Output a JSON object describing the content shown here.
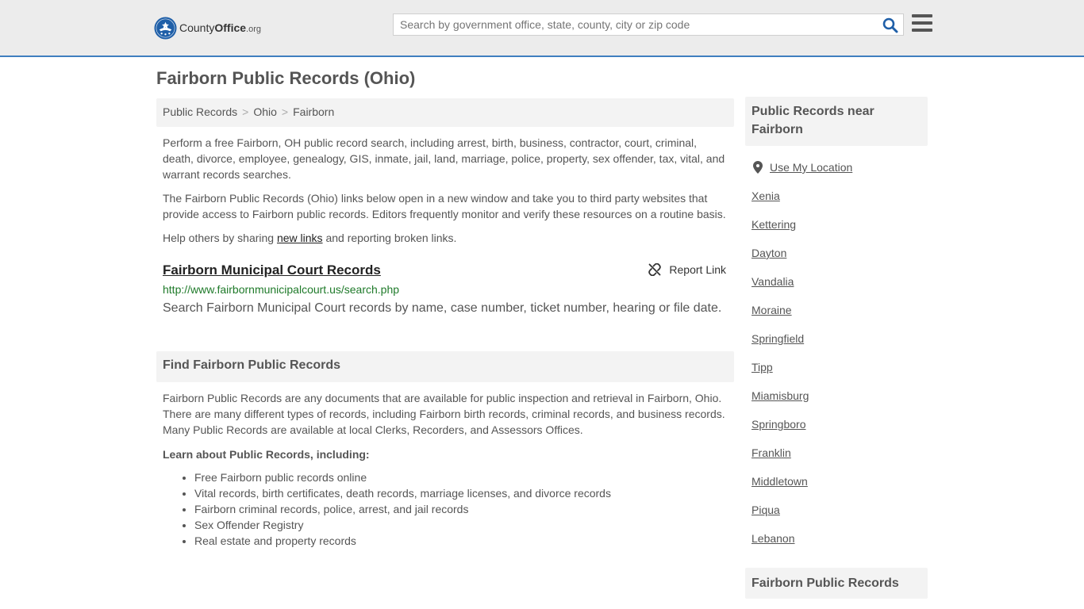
{
  "header": {
    "logo": {
      "brand_primary": "County",
      "brand_bold": "Office",
      "brand_suffix": ".org"
    },
    "search": {
      "placeholder": "Search by government office, state, county, city or zip code"
    },
    "colors": {
      "accent": "#3f7fbf",
      "seal": "#1f5fa8",
      "link_green": "#1f7a2a"
    }
  },
  "page_title": "Fairborn Public Records (Ohio)",
  "breadcrumb": [
    {
      "label": "Public Records"
    },
    {
      "label": "Ohio"
    },
    {
      "label": "Fairborn"
    }
  ],
  "intro": {
    "p1": "Perform a free Fairborn, OH public record search, including arrest, birth, business, contractor, court, criminal, death, divorce, employee, genealogy, GIS, inmate, jail, land, marriage, police, property, sex offender, tax, vital, and warrant records searches.",
    "p2": "The Fairborn Public Records (Ohio) links below open in a new window and take you to third party websites that provide access to Fairborn public records. Editors frequently monitor and verify these resources on a routine basis.",
    "p3_before": "Help others by sharing ",
    "p3_link": "new links",
    "p3_after": " and reporting broken links."
  },
  "record": {
    "title": "Fairborn Municipal Court Records",
    "report_label": "Report Link",
    "url": "http://www.fairbornmunicipalcourt.us/search.php",
    "description": "Search Fairborn Municipal Court records by name, case number, ticket number, hearing or file date."
  },
  "find_section": {
    "heading": "Find Fairborn Public Records",
    "body": "Fairborn Public Records are any documents that are available for public inspection and retrieval in Fairborn, Ohio. There are many different types of records, including Fairborn birth records, criminal records, and business records. Many Public Records are available at local Clerks, Recorders, and Assessors Offices.",
    "learn_heading": "Learn about Public Records, including:",
    "items": [
      "Free Fairborn public records online",
      "Vital records, birth certificates, death records, marriage licenses, and divorce records",
      "Fairborn criminal records, police, arrest, and jail records",
      "Sex Offender Registry",
      "Real estate and property records"
    ]
  },
  "sidebar": {
    "heading": "Public Records near Fairborn",
    "use_location": "Use My Location",
    "cities": [
      "Xenia",
      "Kettering",
      "Dayton",
      "Vandalia",
      "Moraine",
      "Springfield",
      "Tipp",
      "Miamisburg",
      "Springboro",
      "Franklin",
      "Middletown",
      "Piqua",
      "Lebanon"
    ],
    "heading2": "Fairborn Public Records"
  }
}
